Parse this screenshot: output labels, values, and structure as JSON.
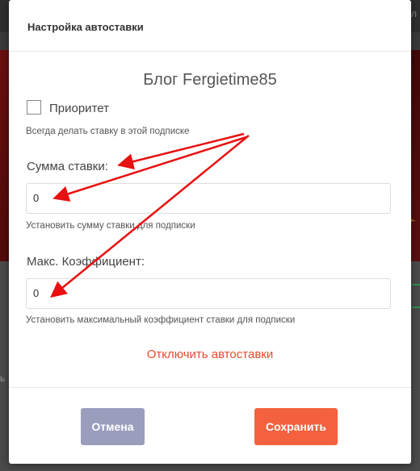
{
  "background": {
    "top_right_text": "ол",
    "side_text": "ь"
  },
  "modal": {
    "title": "Настройка автоставки",
    "blog_title": "Блог Fergietime85",
    "priority": {
      "label": "Приоритет",
      "checked": false,
      "hint": "Всегда делать ставку в этой подписке"
    },
    "bet_amount": {
      "label": "Сумма ставки:",
      "value": "0",
      "hint": "Установить сумму ставки для подписки"
    },
    "max_coef": {
      "label": "Макс. Коэффициент:",
      "value": "0",
      "hint": "Установить максимальный коэффициент ставки для подписки"
    },
    "disable_link": "Отключить автоставки",
    "buttons": {
      "cancel": "Отмена",
      "save": "Сохранить"
    }
  },
  "colors": {
    "accent": "#f4613f",
    "cancel": "#9b9dbd",
    "link": "#e64a2e",
    "annotation_arrow": "#e81010"
  }
}
